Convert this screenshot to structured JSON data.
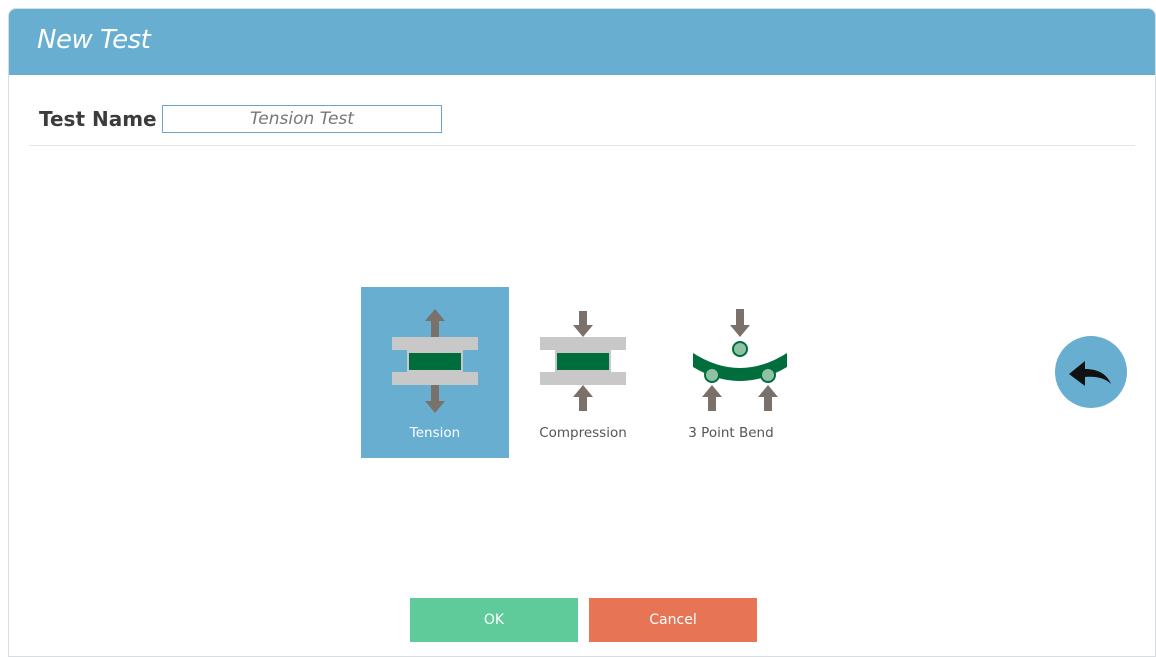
{
  "dialog": {
    "title": "New Test",
    "test_name_label": "Test Name",
    "test_name_value": "Tension Test"
  },
  "test_types": [
    {
      "label": "Tension",
      "icon": "tension-icon",
      "selected": true
    },
    {
      "label": "Compression",
      "icon": "compression-icon",
      "selected": false
    },
    {
      "label": "3 Point Bend",
      "icon": "three-point-bend-icon",
      "selected": false
    }
  ],
  "buttons": {
    "ok_label": "OK",
    "cancel_label": "Cancel",
    "back_icon": "back-arrow-icon"
  },
  "colors": {
    "accent": "#67aed1",
    "ok": "#5fcb9a",
    "cancel": "#e87456",
    "specimen": "#006d3c",
    "arrow": "#7a716b",
    "platen": "#c8c8c8"
  }
}
